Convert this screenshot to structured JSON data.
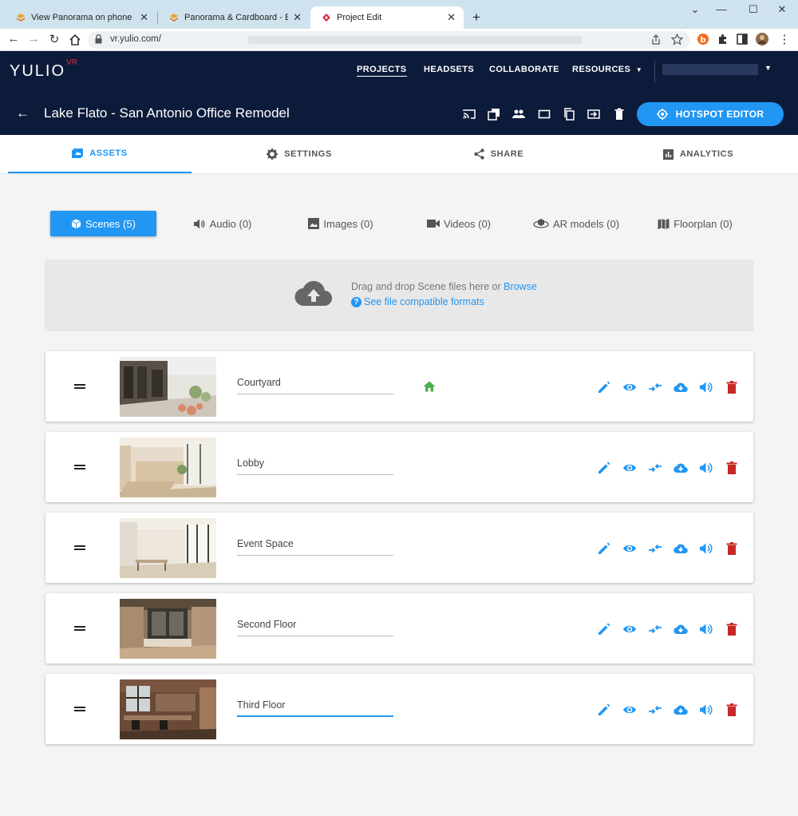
{
  "browser": {
    "tabs": [
      {
        "title": "View Panorama on phone or pc c",
        "active": false
      },
      {
        "title": "Panorama & Cardboard - Enscap",
        "active": false
      },
      {
        "title": "Project Edit",
        "active": true
      }
    ],
    "new_tab": "+",
    "url": "vr.yulio.com/",
    "window_controls": {
      "minimize": "—",
      "maximize": "☐",
      "close": "✕",
      "collapse": "⌄"
    }
  },
  "header": {
    "logo": "YULIO",
    "logo_suffix": "VR",
    "nav": [
      "PROJECTS",
      "HEADSETS",
      "COLLABORATE",
      "RESOURCES"
    ],
    "active_nav": "PROJECTS",
    "project_title": "Lake Flato - San Antonio Office Remodel",
    "hotspot_button": "HOTSPOT EDITOR",
    "toolbar_icons": [
      "cast-icon",
      "layers-icon",
      "users-icon",
      "fullscreen-icon",
      "copy-icon",
      "export-icon",
      "trash-icon"
    ]
  },
  "main_tabs": [
    {
      "label": "ASSETS",
      "icon": "image-icon",
      "active": true
    },
    {
      "label": "SETTINGS",
      "icon": "gear-icon",
      "active": false
    },
    {
      "label": "SHARE",
      "icon": "share-icon",
      "active": false
    },
    {
      "label": "ANALYTICS",
      "icon": "analytics-icon",
      "active": false
    }
  ],
  "asset_tabs": [
    {
      "label": "Scenes (5)",
      "icon": "cube-icon",
      "active": true
    },
    {
      "label": "Audio (0)",
      "icon": "speaker-icon",
      "active": false
    },
    {
      "label": "Images (0)",
      "icon": "image-icon",
      "active": false
    },
    {
      "label": "Videos (0)",
      "icon": "video-icon",
      "active": false
    },
    {
      "label": "AR models (0)",
      "icon": "ar-icon",
      "active": false
    },
    {
      "label": "Floorplan (0)",
      "icon": "map-icon",
      "active": false
    }
  ],
  "dropzone": {
    "text": "Drag and drop Scene files here or",
    "browse": "Browse",
    "formats_link": "See file compatible formats"
  },
  "scenes": [
    {
      "name": "Courtyard",
      "home": true,
      "focused": false
    },
    {
      "name": "Lobby",
      "home": false,
      "focused": false
    },
    {
      "name": "Event Space",
      "home": false,
      "focused": false
    },
    {
      "name": "Second Floor",
      "home": false,
      "focused": false
    },
    {
      "name": "Third Floor",
      "home": false,
      "focused": true
    }
  ],
  "colors": {
    "primary": "#2196f3",
    "header_bg": "#0d1b3a",
    "danger": "#c62828",
    "home": "#4caf50"
  }
}
